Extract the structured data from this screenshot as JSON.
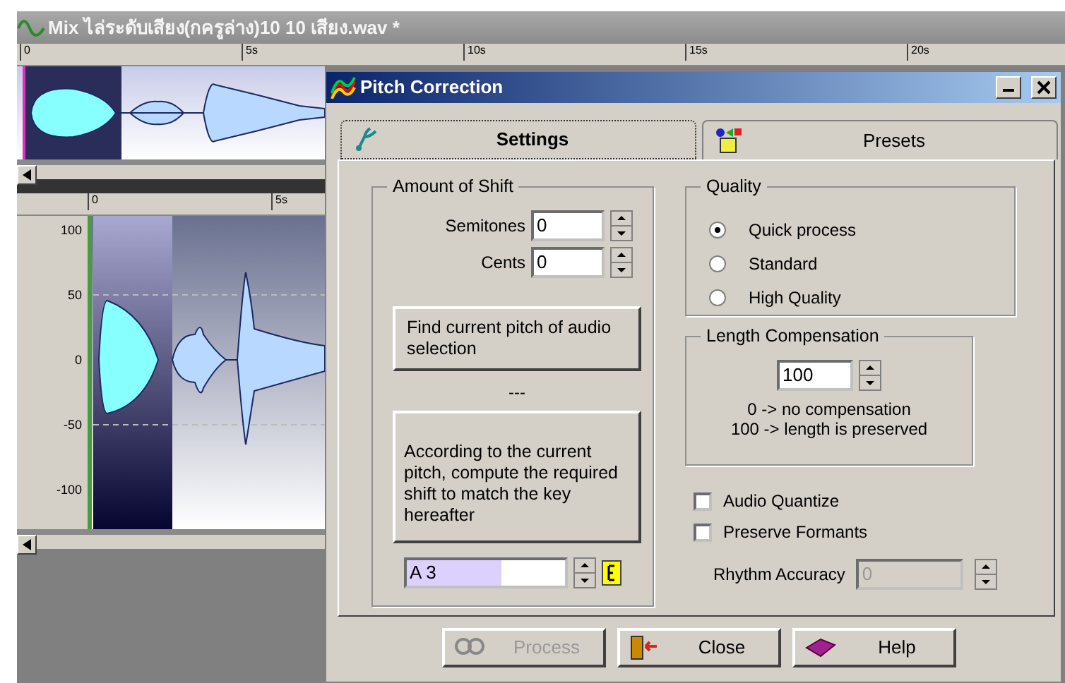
{
  "app": {
    "title": "Mix ไล่ระดับเสียง(กครูล่าง)10 10 เสียง.wav *",
    "ruler": [
      "0",
      "5s",
      "10s",
      "15s",
      "20s"
    ],
    "track_ruler": [
      "0",
      "5s"
    ],
    "y_axis": [
      "100",
      "50",
      "0",
      "-50",
      "-100"
    ]
  },
  "dialog": {
    "title": "Pitch Correction",
    "tabs": [
      {
        "label": "Settings",
        "selected": true
      },
      {
        "label": "Presets",
        "selected": false
      }
    ],
    "amount_of_shift": {
      "title": "Amount of Shift",
      "semitones_label": "Semitones",
      "semitones": "0",
      "cents_label": "Cents",
      "cents": "0",
      "find_button": "Find current pitch of audio selection",
      "separator": "---",
      "compute_button": "According to the current pitch, compute the required shift to match the key hereafter",
      "key": "A 3"
    },
    "quality": {
      "title": "Quality",
      "options": [
        {
          "label": "Quick process",
          "selected": true
        },
        {
          "label": "Standard",
          "selected": false
        },
        {
          "label": "High Quality",
          "selected": false
        }
      ]
    },
    "length_compensation": {
      "title": "Length Compensation",
      "value": "100",
      "notes": [
        "0 -> no compensation",
        "100 -> length is preserved"
      ]
    },
    "checkboxes": [
      {
        "label": "Audio Quantize",
        "checked": false
      },
      {
        "label": "Preserve Formants",
        "checked": false
      }
    ],
    "rhythm_accuracy": {
      "label": "Rhythm Accuracy",
      "value": "0",
      "disabled": true
    },
    "buttons": [
      {
        "kind": "process",
        "label": "Process",
        "disabled": true
      },
      {
        "kind": "close",
        "label": "Close",
        "disabled": false
      },
      {
        "kind": "help",
        "label": "Help",
        "disabled": false
      }
    ]
  }
}
